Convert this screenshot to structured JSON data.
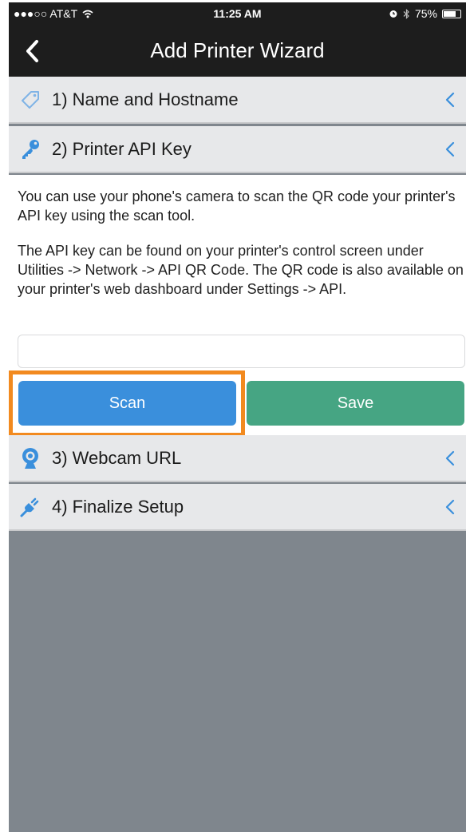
{
  "status_bar": {
    "carrier": "●●●○○ AT&T",
    "time": "11:25 AM",
    "battery": "75%",
    "battery_level": 0.75
  },
  "nav": {
    "title": "Add Printer Wizard"
  },
  "sections": [
    {
      "label": "1) Name and Hostname",
      "icon": "tag-icon"
    },
    {
      "label": "2) Printer API Key",
      "icon": "key-icon"
    },
    {
      "label": "3) Webcam URL",
      "icon": "webcam-icon"
    },
    {
      "label": "4) Finalize Setup",
      "icon": "plug-icon"
    }
  ],
  "api_key_panel": {
    "description_1": "You can use your phone's camera to scan the QR code your printer's API key using the scan tool.",
    "description_2": "The API key can be found on your printer's control screen under Utilities -> Network -> API QR Code.  The QR code is also available on your printer's web dashboard under Settings -> API.",
    "api_key_value": "",
    "scan_label": "Scan",
    "save_label": "Save"
  },
  "colors": {
    "bar_bg": "#1d1d1d",
    "scan_blue": "#3a8fdc",
    "save_green": "#46a583",
    "highlight_orange": "#f28a1f",
    "icon_blue": "#3a8fdc",
    "empty_gray": "#7f868d"
  }
}
